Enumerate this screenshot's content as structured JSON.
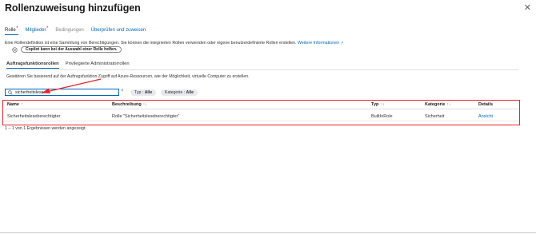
{
  "header": {
    "title": "Rollenzuweisung hinzufügen",
    "more": "···",
    "close": "✕"
  },
  "tabs": [
    {
      "label": "Rolle",
      "dot": "*",
      "state": "active"
    },
    {
      "label": "Mitglieder",
      "dot": "*",
      "state": "link"
    },
    {
      "label": "Bedingungen",
      "dot": "",
      "state": "disabled"
    },
    {
      "label": "Überprüfen und zuweisen",
      "dot": "",
      "state": "link"
    }
  ],
  "description": {
    "text": "Eine Rollendefinition ist eine Sammlung von Berechtigungen. Sie können die integrierten Rollen verwenden oder eigene benutzerdefinierte Rollen erstellen.",
    "link": "Weitere Informationen"
  },
  "copilot": {
    "icon": "copilot-icon",
    "button_label": "Copilot kann bei der Auswahl einer Rolle helfen."
  },
  "subtabs": [
    {
      "label": "Auftragsfunktionsrollen",
      "active": true
    },
    {
      "label": "Privilegierte Administratorrollen",
      "active": false
    }
  ],
  "subdescription": "Gewähren Sie basierend auf der Auftragsfunktion Zugriff auf Azure-Ressourcen, wie der Möglichkeit, virtuelle Computer zu erstellen.",
  "search": {
    "value": "sicherheitslese",
    "clear": "×"
  },
  "filters": [
    {
      "key": "Typ : ",
      "value": "Alle"
    },
    {
      "key": "Kategorie : ",
      "value": "Alle"
    }
  ],
  "table": {
    "columns": [
      {
        "label": "Name",
        "sort": "↑"
      },
      {
        "label": "Beschreibung",
        "sort": "↑↓"
      },
      {
        "label": "Typ",
        "sort": "↑↓"
      },
      {
        "label": "Kategorie",
        "sort": "↑↓"
      },
      {
        "label": "Details",
        "sort": ""
      }
    ],
    "rows": [
      {
        "name": "Sicherheitsleseberechtigter",
        "description": "Rolle \"Sicherheitsleseberechtigter\"",
        "type": "BuiltInRole",
        "category": "Sicherheit",
        "details": "Ansicht"
      }
    ],
    "count_text": "1 – 1 von 1 Ergebnissen werden angezeigt."
  },
  "colors": {
    "accent": "#0067b8",
    "highlight": "#e8252a"
  }
}
